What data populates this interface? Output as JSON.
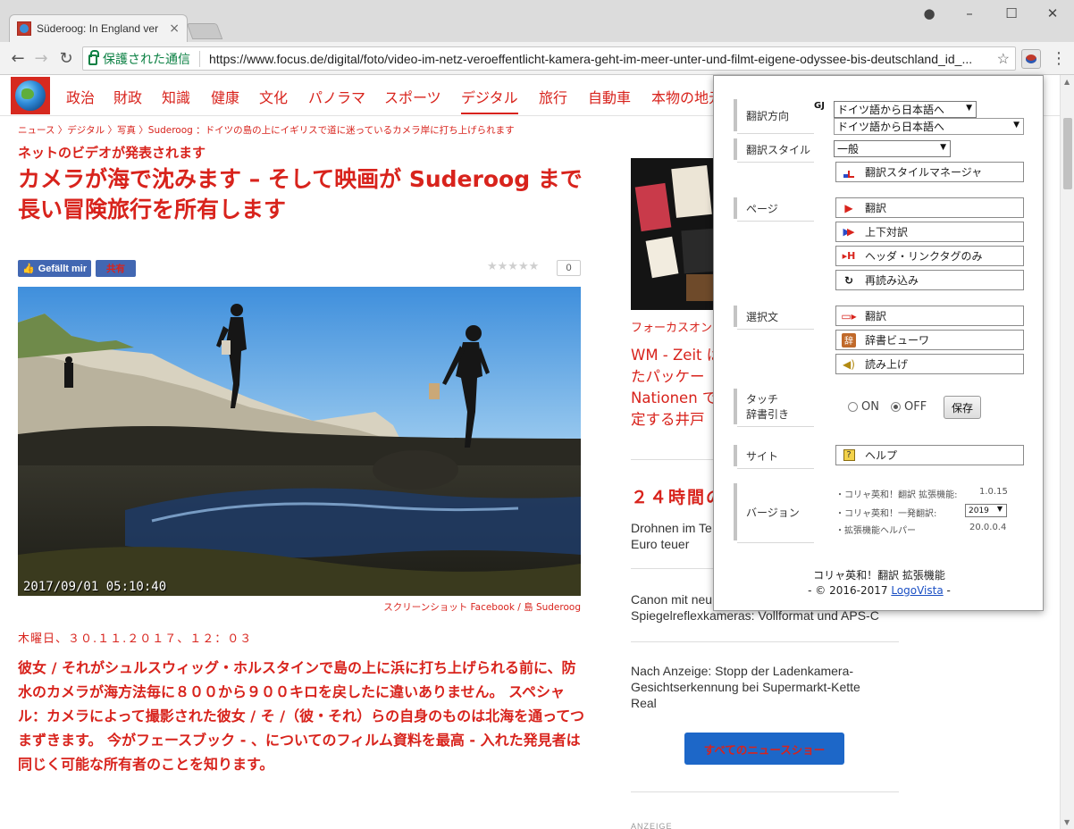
{
  "browser": {
    "tab_title": "Süderoog: In England ver",
    "secure_label": "保護された通信",
    "url": "https://www.focus.de/digital/foto/video-im-netz-veroeffentlicht-kamera-geht-im-meer-unter-und-filmt-eigene-odyssee-bis-deutschland_id_..."
  },
  "site": {
    "nav": [
      "政治",
      "財政",
      "知識",
      "健康",
      "文化",
      "パノラマ",
      "スポーツ",
      "デジタル",
      "旅行",
      "自動車",
      "本物の地元"
    ],
    "active_nav": "デジタル",
    "breadcrumb": "ニュース 〉デジタル 〉写真 〉Suderoog ：ドイツの島の上にイギリスで道に迷っているカメラ岸に打ち上げられます"
  },
  "article": {
    "kicker": "ネットのビデオが発表されます",
    "headline": "カメラが海で沈みます – そして映画が Suderoog まで長い冒険旅行を所有します",
    "like_label": "Gefällt mir",
    "share_label": "共有",
    "stars": "★★★★★",
    "rating_count": "0",
    "photo_timestamp": "2017/09/01  05:10:40",
    "caption": "スクリーンショット Facebook / 島 Suderoog",
    "dateline": "木曜日、３０.１１.２０１７、１２：０３",
    "lead": "彼女 / それがシュルスウィッグ・ホルスタインで島の上に浜に打ち上げられる前に、防水のカメラが海方法毎に８００から９００キロを戻したに違いありません。 スペシャル：カメラによって撮影された彼女 / そ /（彼・それ）らの自身のものは北海を通ってつまずきます。 今がフェースブック - 、についてのフィルム資料を最高 - 入れた発見者は同じく可能な所有者のことを知ります。"
  },
  "sidebar": {
    "promo_label": "フォーカスオン",
    "promo_title": "WM - Zeit は\nたパッケー\nNationen で\n定する井戸",
    "h24": "２４時間の",
    "news": [
      "Drohnen im Te\nEuro teuer",
      "Canon mit neu\nSpiegelreflexkameras: Vollformat und APS-C",
      "Nach Anzeige: Stopp der Ladenkamera-\nGesichtserkennung bei Supermarkt-Kette\nReal"
    ],
    "all_news_button": "すべてのニュースショー",
    "anzeige": "ANZEIGE"
  },
  "popup": {
    "direction_label": "翻訳方向",
    "direction_selected": "ドイツ語から日本語へ",
    "direction_option": "ドイツ語から日本語へ",
    "style_label": "翻訳スタイル",
    "style_selected": "一般",
    "style_manager_button": "翻訳スタイルマネージャ",
    "page_label": "ページ",
    "page_buttons": [
      "翻訳",
      "上下対訳",
      "ヘッダ・リンクタグのみ",
      "再読み込み"
    ],
    "selection_label": "選択文",
    "selection_buttons": [
      "翻訳",
      "辞書ビューワ",
      "読み上げ"
    ],
    "touch_label_1": "タッチ",
    "touch_label_2": "辞書引き",
    "radio_on": "ON",
    "radio_off": "OFF",
    "save_button": "保存",
    "site_label": "サイト",
    "help_button": "ヘルプ",
    "version_label": "バージョン",
    "versions": [
      {
        "name": "・コリャ英和！翻訳 拡張機能:",
        "value": "1.0.15"
      },
      {
        "name": "・コリャ英和！一発翻訳:",
        "value": "2019"
      },
      {
        "name": "・拡張機能ヘルパー",
        "value": "20.0.0.4"
      }
    ],
    "footer_title": "コリャ英和！翻訳 拡張機能",
    "footer_copyright_prefix": "- © 2016-2017 ",
    "footer_link": "LogoVista",
    "footer_copyright_suffix": " -"
  }
}
